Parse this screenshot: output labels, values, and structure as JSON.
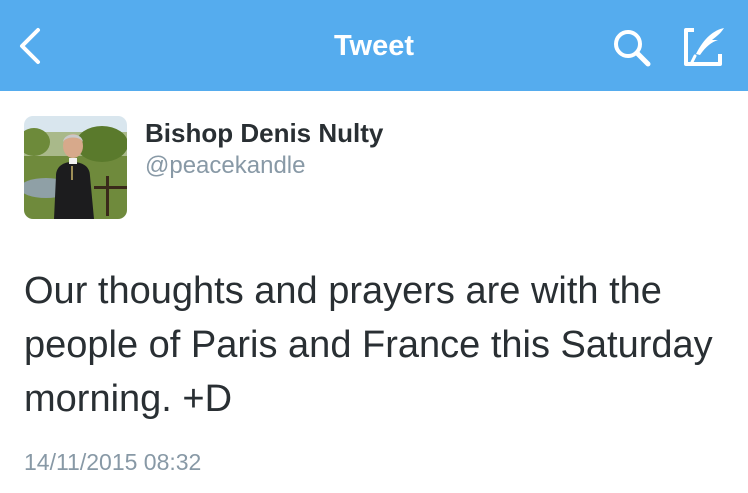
{
  "nav": {
    "title": "Tweet",
    "back_icon": "chevron-left-icon",
    "search_icon": "search-icon",
    "compose_icon": "compose-icon",
    "bar_color": "#55acee"
  },
  "author": {
    "name": "Bishop Denis Nulty",
    "handle": "@peacekandle"
  },
  "tweet": {
    "text": "Our thoughts and prayers are with the people of Paris and France this Saturday morning. +D",
    "timestamp": "14/11/2015 08:32"
  },
  "colors": {
    "text_primary": "#292f33",
    "text_secondary": "#8899a6"
  }
}
